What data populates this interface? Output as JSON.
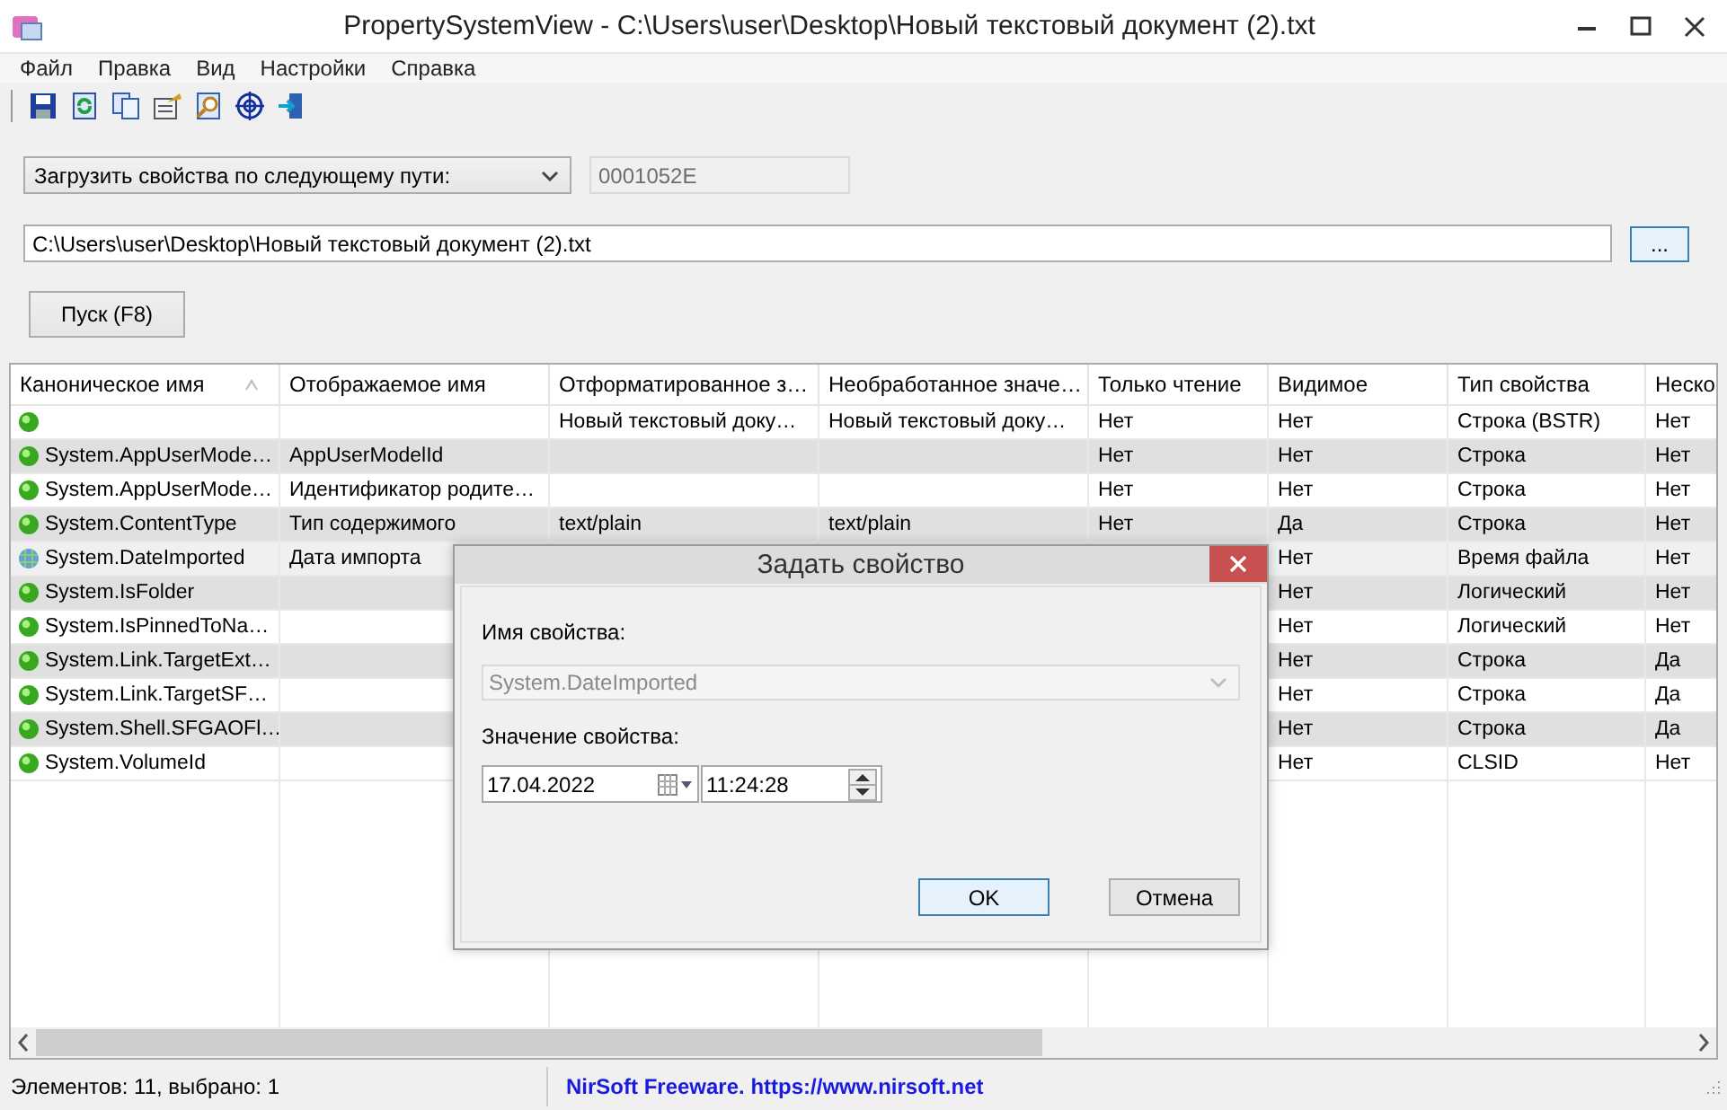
{
  "window": {
    "title": "PropertySystemView  -   C:\\Users\\user\\Desktop\\Новый текстовый документ (2).txt"
  },
  "menu": [
    "Файл",
    "Правка",
    "Вид",
    "Настройки",
    "Справка"
  ],
  "toolbar": [
    {
      "kind": "save"
    },
    {
      "kind": "refresh"
    },
    {
      "kind": "copy"
    },
    {
      "kind": "properties"
    },
    {
      "kind": "find"
    },
    {
      "kind": "target"
    },
    {
      "kind": "exit"
    }
  ],
  "load_mode": {
    "value": "Загрузить свойства по следующему пути:"
  },
  "handle_field": {
    "value": "0001052E",
    "disabled": true
  },
  "path_field": {
    "value": "C:\\Users\\user\\Desktop\\Новый текстовый документ (2).txt"
  },
  "browse_button": "...",
  "run_button": "Пуск (F8)",
  "table": {
    "columns": [
      {
        "label": "Каноническое имя",
        "sorted": true
      },
      {
        "label": "Отображаемое имя"
      },
      {
        "label": "Отформатированное з…"
      },
      {
        "label": "Необработанное значе…"
      },
      {
        "label": "Только чтение"
      },
      {
        "label": "Видимое"
      },
      {
        "label": "Тип свойства"
      },
      {
        "label": "Неско"
      }
    ],
    "rows": [
      {
        "kind": "normal",
        "selected": false,
        "cells": [
          null,
          null,
          "Новый текстовый доку…",
          "Новый текстовый доку…",
          "Нет",
          "Нет",
          "Строка (BSTR)",
          "Нет"
        ]
      },
      {
        "kind": "normal",
        "selected": false,
        "cells": [
          "System.AppUserMode…",
          "AppUserModelId",
          null,
          null,
          "Нет",
          "Нет",
          "Строка",
          "Нет"
        ]
      },
      {
        "kind": "normal",
        "selected": false,
        "cells": [
          "System.AppUserMode…",
          "Идентификатор родите…",
          null,
          null,
          "Нет",
          "Нет",
          "Строка",
          "Нет"
        ]
      },
      {
        "kind": "normal",
        "selected": false,
        "cells": [
          "System.ContentType",
          "Тип содержимого",
          "text/plain",
          "text/plain",
          "Нет",
          "Да",
          "Строка",
          "Нет"
        ]
      },
      {
        "kind": "modified",
        "selected": true,
        "cells": [
          "System.DateImported",
          "Дата импорта",
          null,
          null,
          null,
          "Нет",
          "Время файла",
          "Нет"
        ]
      },
      {
        "kind": "normal",
        "selected": false,
        "cells": [
          "System.IsFolder",
          null,
          null,
          null,
          null,
          "Нет",
          "Логический",
          "Нет"
        ]
      },
      {
        "kind": "normal",
        "selected": false,
        "cells": [
          "System.IsPinnedToNa…",
          null,
          null,
          null,
          null,
          "Нет",
          "Логический",
          "Нет"
        ]
      },
      {
        "kind": "normal",
        "selected": false,
        "cells": [
          "System.Link.TargetExt…",
          null,
          null,
          null,
          null,
          "Нет",
          "Строка",
          "Да"
        ]
      },
      {
        "kind": "normal",
        "selected": false,
        "cells": [
          "System.Link.TargetSF…",
          null,
          null,
          null,
          null,
          "Нет",
          "Строка",
          "Да"
        ]
      },
      {
        "kind": "normal",
        "selected": false,
        "cells": [
          "System.Shell.SFGAOFl…",
          null,
          null,
          null,
          null,
          "Нет",
          "Строка",
          "Да"
        ]
      },
      {
        "kind": "normal",
        "selected": false,
        "cells": [
          "System.VolumeId",
          null,
          null,
          null,
          null,
          "Нет",
          "CLSID",
          "Нет"
        ]
      }
    ]
  },
  "dialog": {
    "title": "Задать свойство",
    "name_label": "Имя свойства:",
    "name_value": "System.DateImported",
    "name_disabled": true,
    "value_label": "Значение свойства:",
    "date": "17.04.2022",
    "time": "11:24:28",
    "buttons": [
      {
        "label": "OK",
        "default": true
      },
      {
        "label": "Отмена",
        "default": false
      }
    ]
  },
  "status_bar": {
    "count": "Элементов: 11, выбрано: 1",
    "link": "NirSoft Freeware. https://www.nirsoft.net"
  }
}
